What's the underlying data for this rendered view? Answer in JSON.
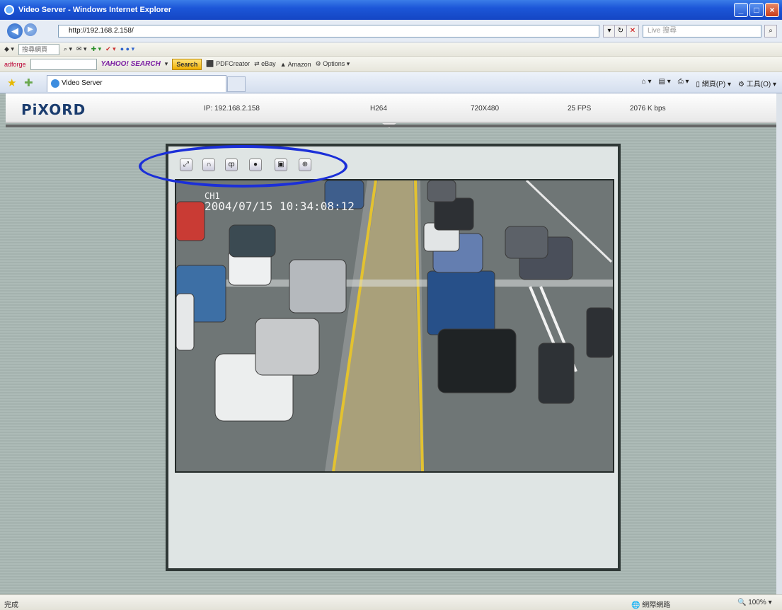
{
  "window": {
    "title": "Video Server - Windows Internet Explorer"
  },
  "address": {
    "url": "http://192.168.2.158/",
    "search_placeholder": "Live 搜尋"
  },
  "toolbar1": {
    "search_box": "搜尋網頁"
  },
  "toolbar2": {
    "brand": "adforge",
    "yahoo": "YAHOO! SEARCH",
    "search_button": "Search",
    "pdf": "PDFCreator",
    "ebay": "eBay",
    "amazon": "Amazon",
    "options": "Options"
  },
  "tab": {
    "title": "Video Server"
  },
  "command_bar": {
    "page": "網頁(P)",
    "tools": "工具(O)"
  },
  "header": {
    "logo": "PiXORD",
    "ip": "IP: 192.168.2.158",
    "codec": "H264",
    "resolution": "720X480",
    "fps": "25 FPS",
    "bitrate": "2076 K bps"
  },
  "video": {
    "timestamp": "2004/07/15 10:34:08:12",
    "channel": "CH1"
  },
  "status": {
    "left": "完成",
    "zone": "網際網路",
    "zoom": "100%"
  }
}
